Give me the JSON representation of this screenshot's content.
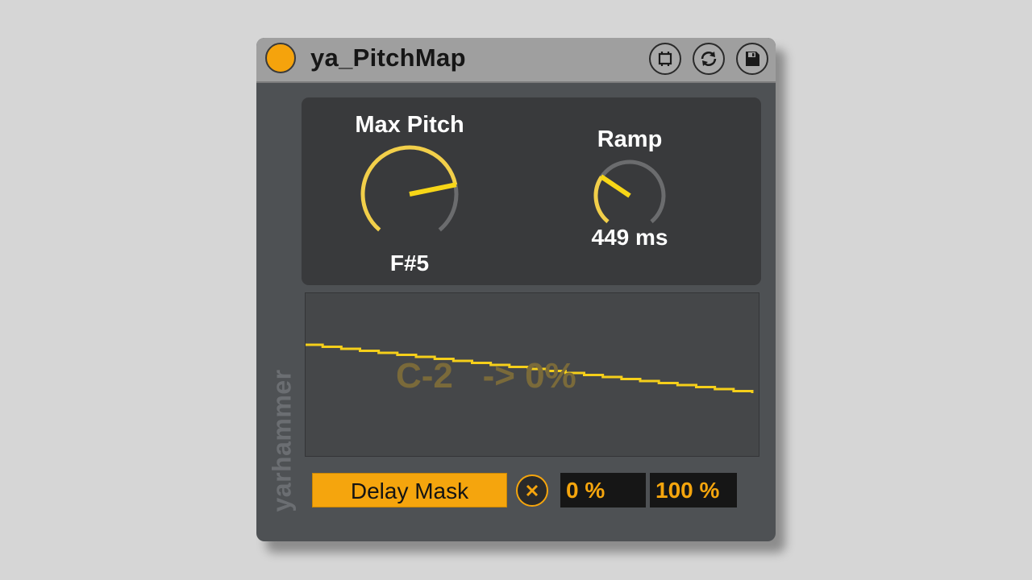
{
  "device": {
    "title": "ya_PitchMap",
    "brand": "yarhammer",
    "accent_color": "#f5a50d",
    "power_on": true
  },
  "titlebar_buttons": [
    {
      "name": "map-button",
      "icon": "map-icon"
    },
    {
      "name": "hot-swap-button",
      "icon": "swap-arrows-icon"
    },
    {
      "name": "save-preset-button",
      "icon": "floppy-disk-icon"
    }
  ],
  "knobs": {
    "max_pitch": {
      "label": "Max Pitch",
      "value_text": "F#5",
      "normalized": 0.78
    },
    "ramp": {
      "label": "Ramp",
      "value_text": "449 ms",
      "normalized": 0.3
    }
  },
  "graph": {
    "overlay_text": "C-2   -> 0%",
    "line_color": "#f5cf1a"
  },
  "controls": {
    "delay_mask_label": "Delay Mask",
    "clear_icon": "x-circle-icon",
    "min_value": "0 %",
    "max_value": "100 %"
  }
}
